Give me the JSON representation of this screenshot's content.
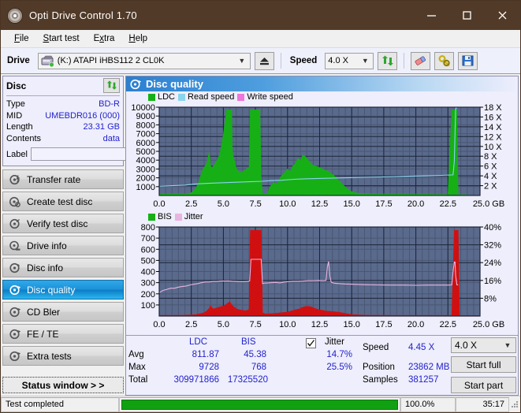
{
  "window": {
    "title": "Opti Drive Control 1.70",
    "app_icon": "disc-icon",
    "minimize": "minimize-icon",
    "maximize": "maximize-icon",
    "close": "close-icon",
    "titlebar_color": "#513a28"
  },
  "menu": [
    {
      "label": "File",
      "accel": "F"
    },
    {
      "label": "Start test",
      "accel": "S"
    },
    {
      "label": "Extra",
      "accel": "x"
    },
    {
      "label": "Help",
      "accel": "H"
    }
  ],
  "toolbar": {
    "drive_label": "Drive",
    "drive_value": "(K:)  ATAPI iHBS112  2 CL0K",
    "eject_icon": "eject-icon",
    "speed_label": "Speed",
    "speed_value": "4.0 X",
    "refresh_icon": "refresh-icon",
    "erase_icon": "eraser-icon",
    "tools_icon": "tools-icon",
    "save_icon": "save-icon"
  },
  "disc_panel": {
    "title": "Disc",
    "refresh_icon": "refresh-icon",
    "rows": [
      {
        "key": "Type",
        "value": "BD-R"
      },
      {
        "key": "MID",
        "value": "UMEBDR016 (000)"
      },
      {
        "key": "Length",
        "value": "23.31 GB"
      },
      {
        "key": "Contents",
        "value": "data"
      }
    ],
    "label_key": "Label",
    "label_value": "",
    "label_placeholder": "",
    "label_button_icon": "disc-icon"
  },
  "sidebar": {
    "items": [
      {
        "label": "Transfer rate",
        "icon": "transfer-rate-icon",
        "selected": false
      },
      {
        "label": "Create test disc",
        "icon": "create-disc-icon",
        "selected": false
      },
      {
        "label": "Verify test disc",
        "icon": "verify-disc-icon",
        "selected": false
      },
      {
        "label": "Drive info",
        "icon": "drive-info-icon",
        "selected": false
      },
      {
        "label": "Disc info",
        "icon": "disc-info-icon",
        "selected": false
      },
      {
        "label": "Disc quality",
        "icon": "disc-quality-icon",
        "selected": true
      },
      {
        "label": "CD Bler",
        "icon": "cd-bler-icon",
        "selected": false
      },
      {
        "label": "FE / TE",
        "icon": "fe-te-icon",
        "selected": false
      },
      {
        "label": "Extra tests",
        "icon": "extra-tests-icon",
        "selected": false
      }
    ],
    "status_window_button": "Status window > >"
  },
  "panel": {
    "header_title": "Disc quality",
    "header_icon": "disc-quality-icon"
  },
  "stats": {
    "col_ldc": "LDC",
    "col_bis": "BIS",
    "jitter_label": "Jitter",
    "jitter_checked": true,
    "row_avg": "Avg",
    "row_max": "Max",
    "row_total": "Total",
    "avg_ldc": "811.87",
    "avg_bis": "45.38",
    "avg_jitter": "14.7%",
    "max_ldc": "9728",
    "max_bis": "768",
    "max_jitter": "25.5%",
    "total_ldc": "309971866",
    "total_bis": "17325520",
    "speed_label": "Speed",
    "speed_value": "4.45 X",
    "position_label": "Position",
    "position_value": "23862 MB",
    "samples_label": "Samples",
    "samples_value": "381257",
    "speed_select": "4.0 X",
    "start_full": "Start full",
    "start_part": "Start part"
  },
  "statusbar": {
    "message": "Test completed",
    "progress_percent": "100.0%",
    "progress_value": 100,
    "elapsed": "35:17",
    "grip_icon": "resize-grip-icon"
  },
  "chart_data": [
    {
      "id": "ldc-chart",
      "type": "area",
      "title": "",
      "xlabel": "GB",
      "ylabel": "",
      "xlim": [
        0,
        25
      ],
      "xticks": [
        0.0,
        2.5,
        5.0,
        7.5,
        10.0,
        12.5,
        15.0,
        17.5,
        20.0,
        22.5,
        25.0
      ],
      "xticklabels": [
        "0.0",
        "2.5",
        "5.0",
        "7.5",
        "10.0",
        "12.5",
        "15.0",
        "17.5",
        "20.0",
        "22.5",
        "25.0 GB"
      ],
      "ylim": [
        0,
        10000
      ],
      "yticks": [
        1000,
        2000,
        3000,
        4000,
        5000,
        6000,
        7000,
        8000,
        9000,
        10000
      ],
      "yticklabels": [
        "1000",
        "2000",
        "3000",
        "4000",
        "5000",
        "6000",
        "7000",
        "8000",
        "9000",
        "10000"
      ],
      "y2lim": [
        0,
        18
      ],
      "y2ticks": [
        2,
        4,
        6,
        8,
        10,
        12,
        14,
        16,
        18
      ],
      "y2ticklabels": [
        "2 X",
        "4 X",
        "6 X",
        "8 X",
        "10 X",
        "12 X",
        "14 X",
        "16 X",
        "18 X"
      ],
      "grid": true,
      "plot_bg": "#5a6a8c",
      "legend_position": "top-left",
      "legend": [
        {
          "name": "LDC",
          "color": "#16b016"
        },
        {
          "name": "Read speed",
          "color": "#8ad4ee"
        },
        {
          "name": "Write speed",
          "color": "#ee77dd"
        }
      ],
      "series": [
        {
          "name": "LDC",
          "color": "#16b016",
          "kind": "area",
          "x": [
            0.0,
            0.2,
            0.5,
            0.8,
            1.1,
            1.4,
            1.7,
            2.0,
            2.3,
            2.6,
            2.9,
            3.1,
            3.3,
            3.5,
            3.7,
            3.9,
            4.0,
            4.1,
            4.2,
            4.35,
            4.5,
            4.7,
            4.9,
            5.1,
            5.25,
            5.35,
            5.45,
            5.55,
            5.65,
            5.7,
            5.8,
            5.9,
            6.0,
            6.2,
            6.4,
            6.6,
            6.8,
            7.0,
            7.1,
            7.2,
            7.3,
            7.45,
            7.6,
            7.75,
            7.85,
            7.95,
            8.05,
            8.2,
            8.4,
            8.6,
            8.9,
            9.2,
            9.5,
            9.8,
            10.0,
            10.2,
            10.4,
            10.6,
            10.8,
            11.0,
            11.2,
            11.4,
            11.6,
            11.8,
            12.0,
            12.3,
            12.6,
            12.9,
            13.2,
            13.5,
            13.8,
            14.0,
            14.2,
            14.4,
            14.6,
            14.8,
            15.0,
            15.2,
            15.5,
            16.0,
            16.5,
            17.0,
            17.5,
            18.0,
            18.5,
            19.0,
            19.5,
            20.0,
            20.5,
            21.0,
            21.5,
            22.0,
            22.5,
            22.8,
            23.0,
            23.1,
            23.2,
            23.3,
            23.4,
            23.5,
            24.0,
            25.0
          ],
          "y": [
            120,
            150,
            140,
            160,
            150,
            170,
            160,
            180,
            200,
            400,
            900,
            1600,
            2600,
            3200,
            3600,
            5000,
            3400,
            3000,
            3300,
            3600,
            4000,
            4600,
            6000,
            8000,
            9700,
            9700,
            9700,
            9700,
            9700,
            5200,
            4200,
            3800,
            3100,
            2700,
            2600,
            2800,
            3000,
            3200,
            9700,
            9700,
            9700,
            9700,
            9700,
            9700,
            9700,
            2200,
            180,
            160,
            150,
            900,
            1500,
            1300,
            2200,
            2600,
            3000,
            2700,
            3300,
            3600,
            4200,
            4000,
            4600,
            4400,
            4000,
            3700,
            3400,
            3300,
            3100,
            2900,
            2700,
            2400,
            2000,
            1700,
            1400,
            1100,
            800,
            600,
            450,
            350,
            260,
            220,
            180,
            170,
            160,
            160,
            150,
            150,
            140,
            140,
            140,
            140,
            130,
            130,
            130,
            9700,
            9700,
            9700,
            9700,
            130,
            120,
            110,
            100
          ]
        },
        {
          "name": "Read speed",
          "color": "#8ad4ee",
          "kind": "line",
          "axis": "y2",
          "x": [
            0.0,
            1.0,
            2.0,
            2.6,
            3.2,
            4.0,
            5.0,
            6.0,
            7.0,
            8.0,
            8.6,
            9.5,
            10.5,
            11.5,
            13.0,
            14.5,
            16.0,
            17.5,
            19.0,
            20.5,
            22.0,
            22.9,
            23.0,
            23.1,
            23.2
          ],
          "y": [
            1.9,
            2.0,
            2.1,
            2.3,
            2.4,
            2.5,
            2.6,
            2.7,
            2.8,
            2.9,
            3.0,
            3.1,
            3.3,
            3.4,
            3.5,
            3.6,
            3.7,
            3.8,
            3.9,
            4.0,
            4.1,
            4.2,
            7.0,
            17.8,
            17.8
          ]
        }
      ]
    },
    {
      "id": "bis-chart",
      "type": "area",
      "title": "",
      "xlabel": "GB",
      "ylabel": "",
      "xlim": [
        0,
        25
      ],
      "xticks": [
        0.0,
        2.5,
        5.0,
        7.5,
        10.0,
        12.5,
        15.0,
        17.5,
        20.0,
        22.5,
        25.0
      ],
      "xticklabels": [
        "0.0",
        "2.5",
        "5.0",
        "7.5",
        "10.0",
        "12.5",
        "15.0",
        "17.5",
        "20.0",
        "22.5",
        "25.0 GB"
      ],
      "ylim": [
        0,
        800
      ],
      "yticks": [
        100,
        200,
        300,
        400,
        500,
        600,
        700,
        800
      ],
      "yticklabels": [
        "100",
        "200",
        "300",
        "400",
        "500",
        "600",
        "700",
        "800"
      ],
      "y2lim": [
        0,
        40
      ],
      "y2ticks": [
        8,
        16,
        24,
        32,
        40
      ],
      "y2ticklabels": [
        "8%",
        "16%",
        "24%",
        "32%",
        "40%"
      ],
      "grid": true,
      "plot_bg": "#5a6a8c",
      "legend_position": "top-left",
      "legend": [
        {
          "name": "BIS",
          "color": "#16b016"
        },
        {
          "name": "Jitter",
          "color": "#e8b4e0"
        }
      ],
      "series": [
        {
          "name": "BIS",
          "color": "#d01010",
          "kind": "area",
          "x": [
            0.0,
            0.5,
            1.0,
            1.5,
            2.0,
            2.5,
            2.9,
            3.2,
            3.5,
            3.7,
            3.9,
            4.0,
            4.1,
            4.2,
            4.4,
            4.6,
            4.8,
            5.0,
            5.2,
            5.4,
            5.5,
            5.6,
            5.8,
            6.0,
            6.2,
            6.4,
            6.6,
            6.8,
            7.0,
            7.1,
            7.2,
            7.3,
            7.5,
            7.7,
            7.85,
            7.95,
            8.05,
            8.2,
            8.5,
            9.0,
            9.5,
            10.0,
            10.3,
            10.6,
            10.9,
            11.2,
            11.5,
            11.8,
            12.1,
            12.5,
            13.0,
            13.5,
            14.0,
            14.4,
            14.8,
            15.0,
            15.2,
            15.5,
            16.0,
            16.5,
            17.0,
            18.0,
            19.0,
            20.0,
            21.0,
            22.0,
            22.6,
            22.8,
            23.0,
            23.1,
            23.2,
            23.3,
            23.4,
            24.0,
            25.0
          ],
          "y": [
            6,
            7,
            6,
            7,
            8,
            10,
            14,
            22,
            30,
            45,
            70,
            95,
            78,
            64,
            70,
            78,
            84,
            90,
            105,
            120,
            130,
            108,
            84,
            66,
            58,
            54,
            50,
            48,
            60,
            770,
            770,
            770,
            770,
            770,
            770,
            770,
            30,
            22,
            20,
            24,
            30,
            36,
            46,
            56,
            64,
            80,
            88,
            84,
            70,
            56,
            46,
            40,
            34,
            26,
            18,
            14,
            12,
            10,
            8,
            7,
            7,
            6,
            6,
            6,
            6,
            6,
            6,
            6,
            770,
            770,
            770,
            770,
            6,
            5,
            5
          ]
        },
        {
          "name": "Jitter",
          "color": "#e8b4e0",
          "kind": "line",
          "axis": "y2",
          "x": [
            0.0,
            0.3,
            0.6,
            0.9,
            1.2,
            1.5,
            1.8,
            2.1,
            2.4,
            2.7,
            3.0,
            3.3,
            3.6,
            3.9,
            4.2,
            4.5,
            4.8,
            5.1,
            5.4,
            5.7,
            6.0,
            6.3,
            6.6,
            6.9,
            7.05,
            7.15,
            7.3,
            7.5,
            7.7,
            7.85,
            7.95,
            8.05,
            8.2,
            8.5,
            8.8,
            9.1,
            9.4,
            9.7,
            10.0,
            10.4,
            10.8,
            11.2,
            11.6,
            12.0,
            12.4,
            12.8,
            13.0,
            13.1,
            13.2,
            13.3,
            13.4,
            13.6,
            14.0,
            14.5,
            15.0,
            15.5,
            16.0,
            17.0,
            18.0,
            19.0,
            20.0,
            21.0,
            22.0,
            22.6,
            22.8,
            22.9,
            23.0,
            23.05,
            23.1,
            23.2,
            23.3
          ],
          "y": [
            10.5,
            11.5,
            12.0,
            12.5,
            12.5,
            13.0,
            13.3,
            13.5,
            14.0,
            14.3,
            14.6,
            15.0,
            15.3,
            15.3,
            15.5,
            15.5,
            15.7,
            15.7,
            15.8,
            15.6,
            15.5,
            15.4,
            15.4,
            15.5,
            15.8,
            25.5,
            25.5,
            25.5,
            25.5,
            25.5,
            25.5,
            14.6,
            14.8,
            14.9,
            15.0,
            15.1,
            14.9,
            15.2,
            15.4,
            15.6,
            15.6,
            15.7,
            15.9,
            15.9,
            16.0,
            15.9,
            16.0,
            22.0,
            24.5,
            18.0,
            15.2,
            14.8,
            14.6,
            14.4,
            14.3,
            14.2,
            14.1,
            14.0,
            13.9,
            13.9,
            13.8,
            13.9,
            13.9,
            13.9,
            14.0,
            20.0,
            24.3,
            24.3,
            18.0,
            14.0,
            14.0
          ]
        }
      ]
    }
  ]
}
